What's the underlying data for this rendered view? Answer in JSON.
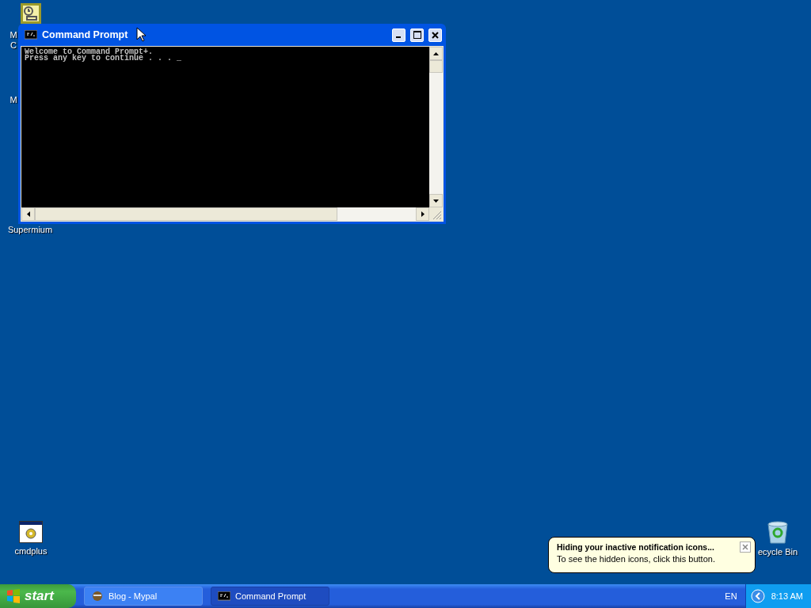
{
  "desktop_icons": [
    {
      "kind": "clock"
    },
    {
      "kind": "label",
      "label": "M"
    },
    {
      "kind": "label",
      "label": "C"
    },
    {
      "kind": "label",
      "label": "M"
    },
    {
      "kind": "label",
      "label": "Supermium"
    },
    {
      "kind": "settings",
      "label": "cmdplus"
    },
    {
      "kind": "recycle",
      "label": "ecycle Bin"
    }
  ],
  "window": {
    "title": "Command Prompt",
    "active": true,
    "console_lines": [
      "Welcome to Command Prompt+.",
      "Press any key to continue . . . _"
    ]
  },
  "balloon": {
    "title": "Hiding your inactive notification icons...",
    "text": "To see the hidden icons, click this button."
  },
  "taskbar": {
    "start": "start",
    "items": [
      {
        "kind": "browser",
        "label": "Blog - Mypal",
        "selected": false
      },
      {
        "kind": "console",
        "label": "Command Prompt",
        "selected": true
      }
    ],
    "language": "EN",
    "clock": "8:13 AM"
  }
}
